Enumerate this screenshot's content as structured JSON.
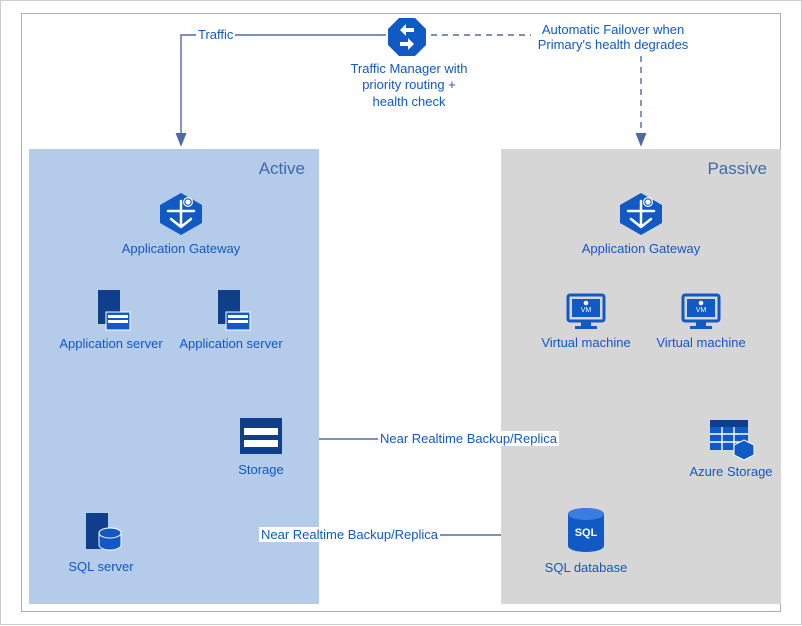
{
  "top": {
    "traffic_manager_label": "Traffic Manager with priority routing + health check",
    "traffic_label": "Traffic",
    "failover_label": "Automatic Failover when Primary's health degrades"
  },
  "active": {
    "title": "Active",
    "app_gateway_label": "Application Gateway",
    "app_server_label_1": "Application server",
    "app_server_label_2": "Application server",
    "storage_label": "Storage",
    "sql_server_label": "SQL server"
  },
  "passive": {
    "title": "Passive",
    "app_gateway_label": "Application Gateway",
    "vm_label_1": "Virtual machine",
    "vm_label_2": "Virtual machine",
    "azure_storage_label": "Azure Storage"
  },
  "center": {
    "sql_db_label": "SQL database",
    "backup_label_storage": "Near Realtime Backup/Replica",
    "backup_label_sql": "Near Realtime Backup/Replica"
  },
  "colors": {
    "azure_blue": "#1159c4",
    "deep_blue": "#0f3e8a",
    "line": "#4d6aa6"
  }
}
